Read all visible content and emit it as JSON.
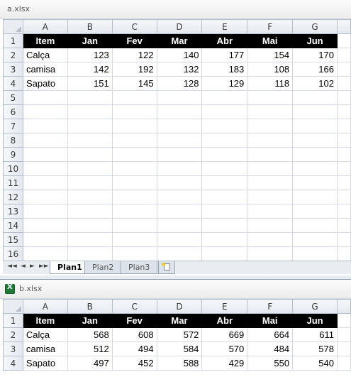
{
  "window_a": {
    "title": "a.xlsx",
    "columns": [
      "A",
      "B",
      "C",
      "D",
      "E",
      "F",
      "G"
    ],
    "header_row": [
      "Item",
      "Jan",
      "Fev",
      "Mar",
      "Abr",
      "Mai",
      "Jun"
    ],
    "data_rows": [
      [
        "Calça",
        "123",
        "122",
        "140",
        "177",
        "154",
        "170"
      ],
      [
        "camisa",
        "142",
        "192",
        "132",
        "183",
        "108",
        "166"
      ],
      [
        "Sapato",
        "151",
        "145",
        "128",
        "129",
        "118",
        "102"
      ]
    ],
    "row_numbers": [
      "1",
      "2",
      "3",
      "4",
      "5",
      "6",
      "7",
      "8",
      "9",
      "10",
      "11",
      "12",
      "13",
      "14",
      "15",
      "16"
    ],
    "sheet_tabs": [
      "Plan1",
      "Plan2",
      "Plan3"
    ],
    "active_tab": "Plan1",
    "nav_buttons": [
      "◄◄",
      "◄",
      "►",
      "►►"
    ]
  },
  "window_b": {
    "title": "b.xlsx",
    "columns": [
      "A",
      "B",
      "C",
      "D",
      "E",
      "F",
      "G"
    ],
    "header_row": [
      "Item",
      "Jan",
      "Fev",
      "Mar",
      "Abr",
      "Mai",
      "Jun"
    ],
    "data_rows": [
      [
        "Calça",
        "568",
        "608",
        "572",
        "669",
        "664",
        "611"
      ],
      [
        "camisa",
        "512",
        "494",
        "584",
        "570",
        "484",
        "578"
      ],
      [
        "Sapato",
        "497",
        "452",
        "588",
        "429",
        "550",
        "540"
      ]
    ],
    "row_numbers": [
      "1",
      "2",
      "3",
      "4"
    ]
  },
  "colors": {
    "header_fill": "#000000",
    "header_text": "#ffffff",
    "excel_green": "#1f7a3a",
    "grid_line": "#d6dbe3"
  }
}
